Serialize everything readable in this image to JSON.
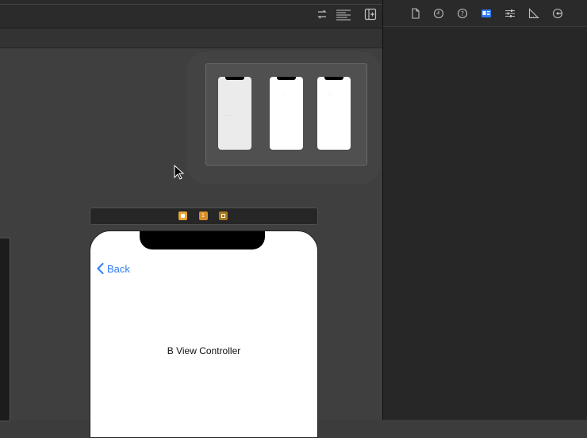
{
  "canvas": {
    "minimap": {
      "scenes": [
        {
          "title": "",
          "body": "· · · · · · · · ·",
          "link": ""
        },
        {
          "title": "· · ·",
          "body": "",
          "link": "· ·"
        },
        {
          "title": "· · ·",
          "body": "",
          "link": ""
        }
      ]
    },
    "scene": {
      "dock_icons": [
        "view-controller-icon",
        "first-responder-icon",
        "exit-icon"
      ],
      "back_label": "Back",
      "view_title": "B View Controller"
    }
  },
  "inspector": {
    "tabs": [
      "file-inspector",
      "history-inspector",
      "quick-help-inspector",
      "identity-inspector",
      "attributes-inspector",
      "size-inspector",
      "connections-inspector"
    ],
    "selected_tab": "identity-inspector",
    "accent": "#2f7cf6"
  }
}
